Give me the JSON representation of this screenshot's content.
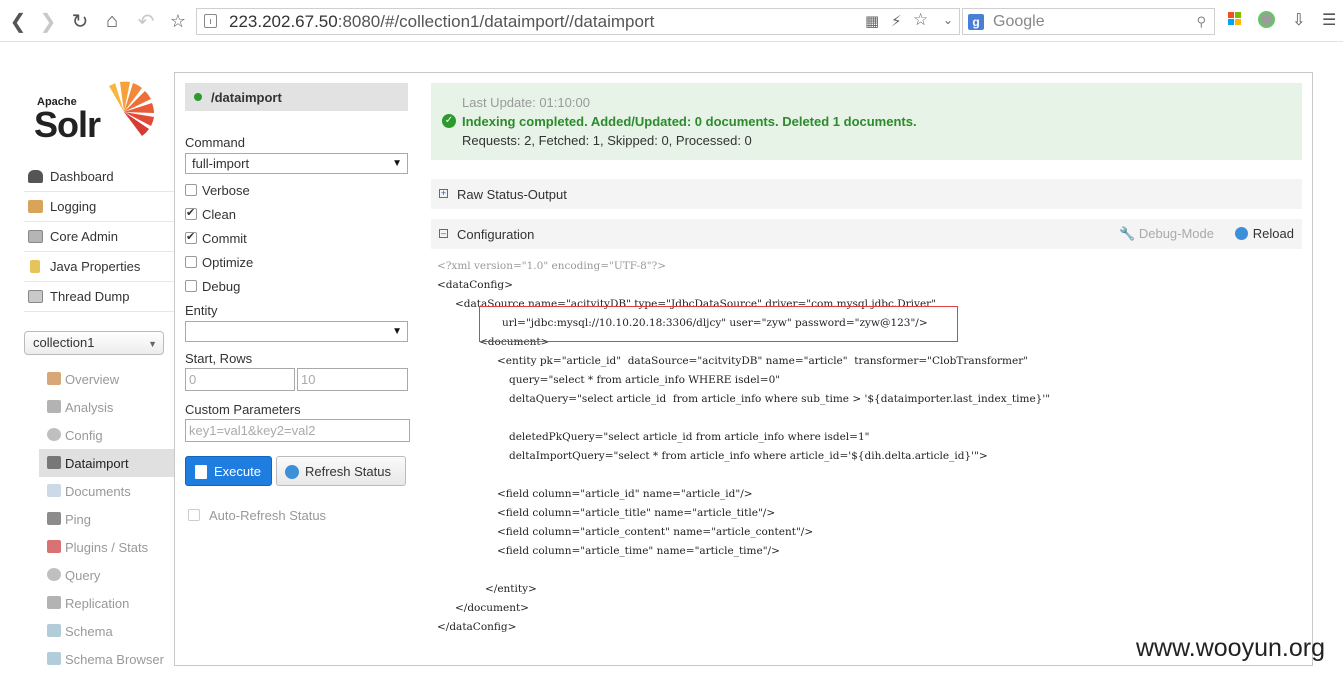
{
  "browser": {
    "url_host": "223.202.67.50",
    "url_rest": ":8080/#/collection1/dataimport//dataimport",
    "search_placeholder": "Google"
  },
  "logo": {
    "apache": "Apache",
    "solr": "Solr"
  },
  "leftnav": {
    "items": [
      "Dashboard",
      "Logging",
      "Core Admin",
      "Java Properties",
      "Thread Dump"
    ]
  },
  "core_selector": {
    "value": "collection1"
  },
  "core_menu": [
    "Overview",
    "Analysis",
    "Config",
    "Dataimport",
    "Documents",
    "Ping",
    "Plugins / Stats",
    "Query",
    "Replication",
    "Schema",
    "Schema Browser"
  ],
  "form": {
    "handler": "/dataimport",
    "command_label": "Command",
    "command_value": "full-import",
    "verbose": "Verbose",
    "clean": "Clean",
    "commit": "Commit",
    "optimize": "Optimize",
    "debug": "Debug",
    "entity_label": "Entity",
    "entity_value": "",
    "start_rows_label": "Start, Rows",
    "start_value": "0",
    "rows_value": "10",
    "custom_params_label": "Custom Parameters",
    "custom_params_placeholder": "key1=val1&key2=val2",
    "execute": "Execute",
    "refresh_status": "Refresh Status",
    "auto_refresh": "Auto-Refresh Status"
  },
  "status": {
    "last_update": "Last Update: 01:10:00",
    "message": "Indexing completed. Added/Updated: 0 documents. Deleted 1 documents.",
    "requests": "Requests: 2, Fetched: 1, Skipped: 0, Processed: 0"
  },
  "sections": {
    "raw": "Raw Status-Output",
    "config": "Configuration",
    "debug_mode": "Debug-Mode",
    "reload": "Reload"
  },
  "config_lines": [
    "<?xml version=\"1.0\" encoding=\"UTF-8\"?>",
    "<dataConfig>",
    "<dataSource name=\"acitvityDB\" type=\"JdbcDataSource\" driver=\"com.mysql.jdbc.Driver\"",
    "url=\"jdbc:mysql://10.10.20.18:3306/dljcy\" user=\"zyw\" password=\"zyw@123\"/>",
    "<document>",
    "<entity pk=\"article_id\"  dataSource=\"acitvityDB\" name=\"article\"  transformer=\"ClobTransformer\"",
    "query=\"select * from article_info WHERE isdel=0\"",
    "deltaQuery=\"select article_id  from article_info where sub_time > '${dataimporter.last_index_time}'\"",
    "deletedPkQuery=\"select article_id from article_info where isdel=1\"",
    "deltaImportQuery=\"select * from article_info where article_id='${dih.delta.article_id}'\">",
    "<field column=\"article_id\" name=\"article_id\"/>",
    "<field column=\"article_title\" name=\"article_title\"/>",
    "<field column=\"article_content\" name=\"article_content\"/>",
    "<field column=\"article_time\" name=\"article_time\"/>",
    "</entity>",
    "</document>",
    "</dataConfig>"
  ],
  "watermark": "www.wooyun.org"
}
